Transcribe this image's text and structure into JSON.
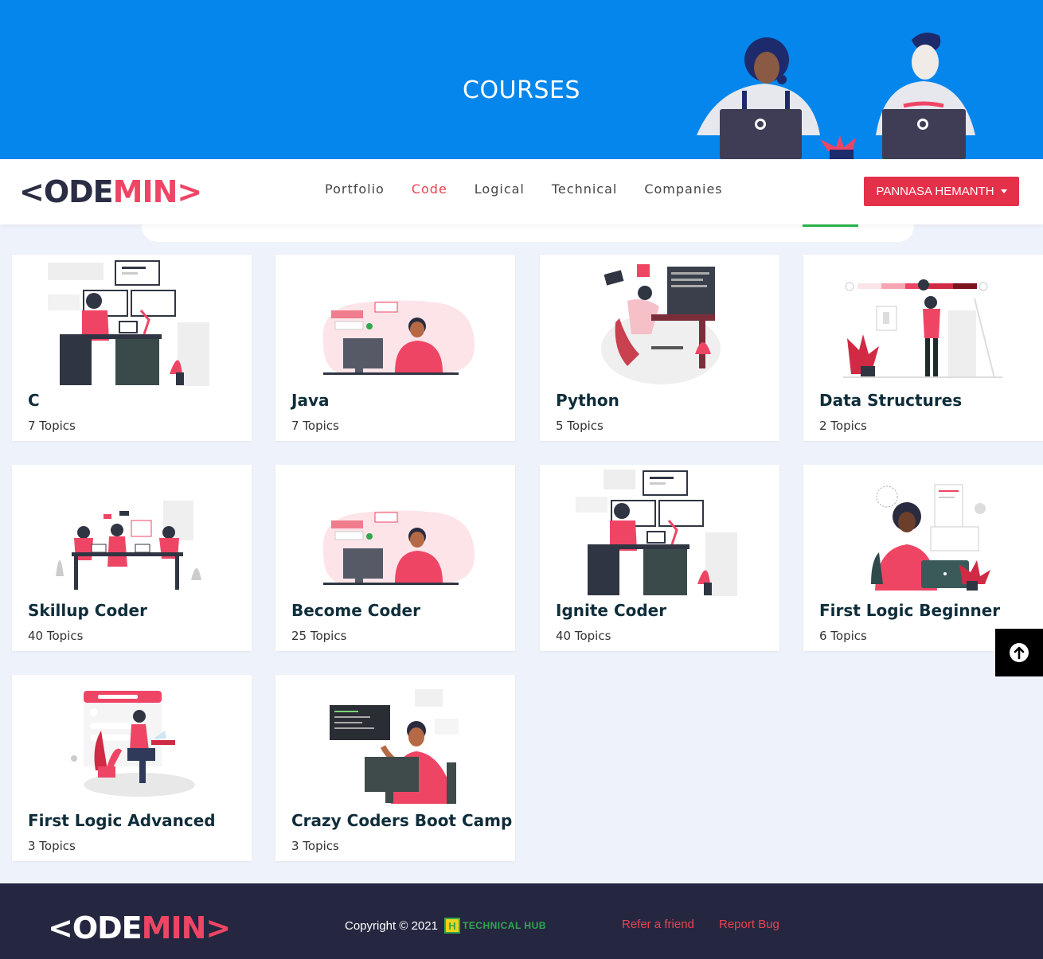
{
  "hero": {
    "title": "COURSES"
  },
  "logo": {
    "left": "<ODE",
    "right": "MIN>"
  },
  "nav": {
    "items": [
      {
        "label": "Portfolio",
        "active": false
      },
      {
        "label": "Code",
        "active": true
      },
      {
        "label": "Logical",
        "active": false
      },
      {
        "label": "Technical",
        "active": false
      },
      {
        "label": "Companies",
        "active": false
      }
    ],
    "user_menu": "PANNASA HEMANTH"
  },
  "courses": [
    {
      "title": "C",
      "topics": "7 Topics"
    },
    {
      "title": "Java",
      "topics": "7 Topics"
    },
    {
      "title": "Python",
      "topics": "5 Topics"
    },
    {
      "title": "Data Structures",
      "topics": "2 Topics"
    },
    {
      "title": "Skillup Coder",
      "topics": "40 Topics"
    },
    {
      "title": "Become Coder",
      "topics": "25 Topics"
    },
    {
      "title": "Ignite Coder",
      "topics": "40 Topics"
    },
    {
      "title": "First Logic Beginner",
      "topics": "6 Topics"
    },
    {
      "title": "First Logic Advanced",
      "topics": "3 Topics"
    },
    {
      "title": "Crazy Coders Boot Camp",
      "topics": "3 Topics"
    }
  ],
  "footer": {
    "copyright": "Copyright © 2021",
    "brand_mark": "H",
    "brand_text": "TECHNICAL HUB",
    "refer": "Refer a friend",
    "report": "Report Bug"
  },
  "colors": {
    "hero": "#0486ed",
    "accent": "#e5304a",
    "footer": "#252740",
    "brand_green": "#2fa84f"
  }
}
